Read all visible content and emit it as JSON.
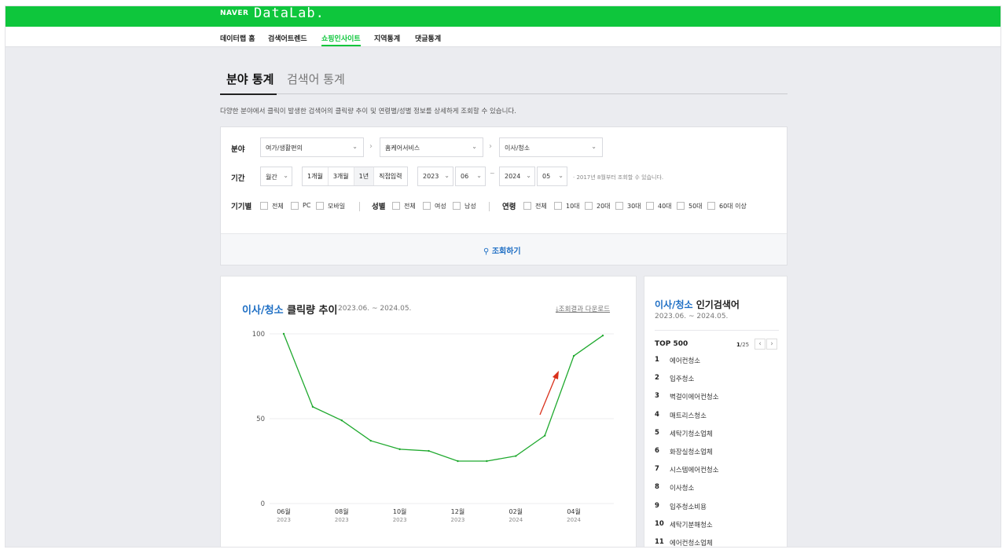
{
  "header": {
    "brand": "NAVER",
    "app": "DataLab."
  },
  "gnb": [
    "데이터랩 홈",
    "검색어트렌드",
    "쇼핑인사이트",
    "지역통계",
    "댓글통계"
  ],
  "tabs": {
    "active": "분야 통계",
    "other": "검색어 통계"
  },
  "description": "다양한 분야에서 클릭이 발생한 검색어의 클릭량 추이 및 연령별/성별 정보를 상세하게 조회할 수 있습니다.",
  "filter": {
    "category_label": "분야",
    "cat1": "여가/생활편의",
    "cat2": "홈케어서비스",
    "cat3": "이사/청소",
    "period_label": "기간",
    "period_unit": "월간",
    "period_buttons": [
      "1개월",
      "3개월",
      "1년",
      "직접입력"
    ],
    "start_year": "2023",
    "start_month": "06",
    "end_year": "2024",
    "end_month": "05",
    "range_sep": "~",
    "period_note": "· 2017년 8월부터 조회할 수 있습니다.",
    "device_label": "기기별",
    "device_opts": [
      "전체",
      "PC",
      "모바일"
    ],
    "gender_label": "성별",
    "gender_opts": [
      "전체",
      "여성",
      "남성"
    ],
    "age_label": "연령",
    "age_opts": [
      "전체",
      "10대",
      "20대",
      "30대",
      "40대",
      "50대",
      "60대 이상"
    ],
    "search_button": "조회하기"
  },
  "chart_panel": {
    "title_highlight": "이사/청소",
    "title_rest": "클릭량 추이",
    "range": "2023.06. ~ 2024.05.",
    "download": "조회결과 다운로드"
  },
  "chart_data": {
    "type": "line",
    "x": [
      "2023-06",
      "2023-07",
      "2023-08",
      "2023-09",
      "2023-10",
      "2023-11",
      "2023-12",
      "2024-01",
      "2024-02",
      "2024-03",
      "2024-04",
      "2024-05"
    ],
    "values": [
      100,
      57,
      49,
      37,
      32,
      31,
      25,
      25,
      28,
      40,
      87,
      99
    ],
    "ylim": [
      0,
      100
    ],
    "yticks": [
      "100",
      "50",
      "0"
    ],
    "xtick_labels": [
      {
        "month": "06월",
        "year": "2023",
        "index": 0
      },
      {
        "month": "08월",
        "year": "2023",
        "index": 2
      },
      {
        "month": "10월",
        "year": "2023",
        "index": 4
      },
      {
        "month": "12월",
        "year": "2023",
        "index": 6
      },
      {
        "month": "02월",
        "year": "2024",
        "index": 8
      },
      {
        "month": "04월",
        "year": "2024",
        "index": 10
      }
    ],
    "line_color": "#1fa92e",
    "annotation_color": "#d9301b",
    "grid": true
  },
  "popular": {
    "title_highlight": "이사/청소",
    "title_rest": "인기검색어",
    "range": "2023.06. ~ 2024.05.",
    "top_label": "TOP 500",
    "page": "1",
    "total": "/25",
    "items": [
      {
        "rank": "1",
        "kw": "에어컨청소"
      },
      {
        "rank": "2",
        "kw": "입주청소"
      },
      {
        "rank": "3",
        "kw": "벽걸이에어컨청소"
      },
      {
        "rank": "4",
        "kw": "매트리스청소"
      },
      {
        "rank": "5",
        "kw": "세탁기청소업체"
      },
      {
        "rank": "6",
        "kw": "화장실청소업체"
      },
      {
        "rank": "7",
        "kw": "시스템에어컨청소"
      },
      {
        "rank": "8",
        "kw": "이사청소"
      },
      {
        "rank": "9",
        "kw": "입주청소비용"
      },
      {
        "rank": "10",
        "kw": "세탁기분해청소"
      },
      {
        "rank": "11",
        "kw": "에어컨청소업체"
      }
    ]
  }
}
